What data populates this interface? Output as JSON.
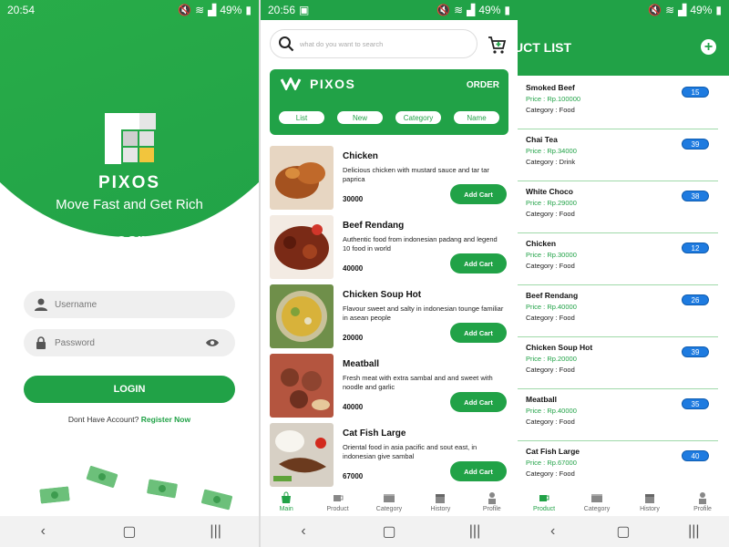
{
  "colors": {
    "brand_green": "#21a247",
    "badge_blue": "#1e7be0",
    "bg_light": "#efefef"
  },
  "status_bars": [
    {
      "time": "20:54",
      "battery": "49%"
    },
    {
      "time": "20:56",
      "battery": "49%"
    },
    {
      "time": "",
      "battery": "49%"
    }
  ],
  "login_screen": {
    "brand": "PIXOS",
    "tagline": "Move Fast and Get Rich",
    "title": "LOGIN",
    "username_placeholder": "Username",
    "password_placeholder": "Password",
    "login_button": "LOGIN",
    "signup_prompt": "Dont Have Account?",
    "signup_link": "Register Now"
  },
  "main_screen": {
    "search_placeholder": "what do you want to search",
    "brand": "PIXOS",
    "order_label": "ORDER",
    "filters": [
      "List",
      "New",
      "Category",
      "Name"
    ],
    "products": [
      {
        "name": "Chicken",
        "description": "Delicious chicken with mustard sauce and tar tar paprica",
        "price": "30000",
        "button": "Add Cart",
        "image": "fried-chicken-photo"
      },
      {
        "name": "Beef Rendang",
        "description": "Authentic food from indonesian padang and legend 10 food in world",
        "price": "40000",
        "button": "Add Cart",
        "image": "beef-rendang-photo"
      },
      {
        "name": "Chicken Soup Hot",
        "description": "Flavour sweet and salty in indonesian tounge familiar in asean people",
        "price": "20000",
        "button": "Add Cart",
        "image": "chicken-soup-photo"
      },
      {
        "name": "Meatball",
        "description": "Fresh meat with extra sambal and and sweet with noodle and garlic",
        "price": "40000",
        "button": "Add Cart",
        "image": "meatball-photo"
      },
      {
        "name": "Cat Fish Large",
        "description": "Oriental food in asia pacific and sout east, in indonesian give sambal",
        "price": "67000",
        "button": "Add Cart",
        "image": "catfish-photo"
      }
    ],
    "tabs": [
      {
        "label": "Main",
        "icon": "bag-icon",
        "active": true
      },
      {
        "label": "Product",
        "icon": "cup-icon",
        "active": false
      },
      {
        "label": "Category",
        "icon": "box-icon",
        "active": false
      },
      {
        "label": "History",
        "icon": "calendar-icon",
        "active": false
      },
      {
        "label": "Profile",
        "icon": "person-icon",
        "active": false
      }
    ]
  },
  "product_list_screen": {
    "title": "UCT LIST",
    "items": [
      {
        "name": "Smoked Beef",
        "price": "Price : Rp.100000",
        "category": "Category : Food",
        "qty": "15"
      },
      {
        "name": "Chai Tea",
        "price": "Price : Rp.34000",
        "category": "Category : Drink",
        "qty": "39"
      },
      {
        "name": "White Choco",
        "price": "Price : Rp.29000",
        "category": "Category : Food",
        "qty": "38"
      },
      {
        "name": "Chicken",
        "price": "Price : Rp.30000",
        "category": "Category : Food",
        "qty": "12"
      },
      {
        "name": "Beef Rendang",
        "price": "Price : Rp.40000",
        "category": "Category : Food",
        "qty": "26"
      },
      {
        "name": "Chicken Soup Hot",
        "price": "Price : Rp.20000",
        "category": "Category : Food",
        "qty": "39"
      },
      {
        "name": "Meatball",
        "price": "Price : Rp.40000",
        "category": "Category : Food",
        "qty": "35"
      },
      {
        "name": "Cat Fish Large",
        "price": "Price : Rp.67000",
        "category": "Category : Food",
        "qty": "40"
      }
    ],
    "tabs": [
      {
        "label": "Product",
        "icon": "cup-icon",
        "active": true
      },
      {
        "label": "Category",
        "icon": "box-icon",
        "active": false
      },
      {
        "label": "History",
        "icon": "calendar-icon",
        "active": false
      },
      {
        "label": "Profile",
        "icon": "person-icon",
        "active": false
      }
    ]
  },
  "android_nav": {
    "back": "back-icon",
    "home": "home-icon",
    "recents": "recents-icon"
  }
}
